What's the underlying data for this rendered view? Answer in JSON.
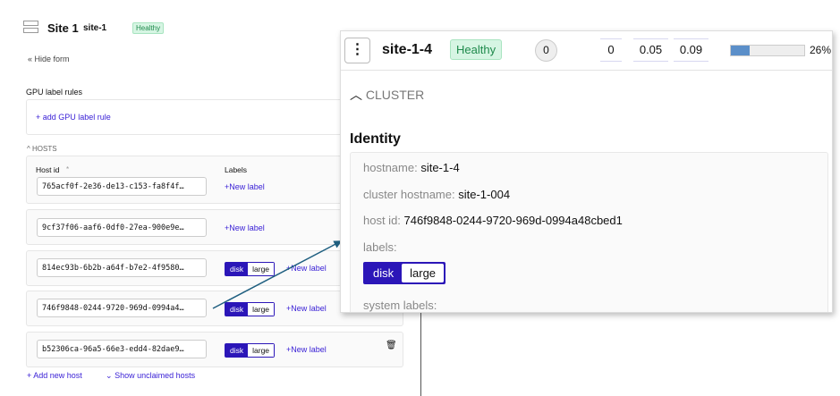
{
  "site": {
    "title": "Site 1",
    "id": "site-1",
    "status": "Healthy"
  },
  "hide_form": "Hide form",
  "gpu": {
    "heading": "GPU label rules",
    "add": "+ add GPU label rule"
  },
  "hosts": {
    "section": "HOSTS",
    "host_id_label": "Host id",
    "required": "*",
    "labels_label": "Labels",
    "new_label": "+New label",
    "rows": [
      {
        "id": "765acf0f-2e36-de13-c153-fa8f4f…",
        "labels": []
      },
      {
        "id": "9cf37f06-aaf6-0df0-27ea-900e9e…",
        "labels": []
      },
      {
        "id": "814ec93b-6b2b-a64f-b7e2-4f9580…",
        "labels": [
          {
            "key": "disk",
            "value": "large"
          }
        ]
      },
      {
        "id": "746f9848-0244-9720-969d-0994a4…",
        "labels": [
          {
            "key": "disk",
            "value": "large"
          }
        ]
      },
      {
        "id": "b52306ca-96a5-66e3-edd4-82dae9…",
        "labels": [
          {
            "key": "disk",
            "value": "large"
          }
        ]
      }
    ],
    "add_host": "+ Add new host",
    "show_unclaimed": "Show unclaimed hosts"
  },
  "popup": {
    "name": "site-1-4",
    "status": "Healthy",
    "count": "0",
    "v1": "0",
    "v2": "0.05",
    "v3": "0.09",
    "progress_pct": 26,
    "progress_label": "26%",
    "section": "CLUSTER",
    "identity": "Identity",
    "hostname_label": "hostname:",
    "hostname": "site-1-4",
    "cluster_hostname_label": "cluster hostname:",
    "cluster_hostname": "site-1-004",
    "host_id_label": "host id:",
    "host_id": "746f9848-0244-9720-969d-0994a48cbed1",
    "labels_label": "labels:",
    "label_key": "disk",
    "label_value": "large",
    "system_labels_label": "system labels:"
  },
  "colors": {
    "accent": "#2b16b8",
    "healthy_bg": "#d6f5e3",
    "arrow": "#1f5f80",
    "progress": "#5b8fc9"
  }
}
